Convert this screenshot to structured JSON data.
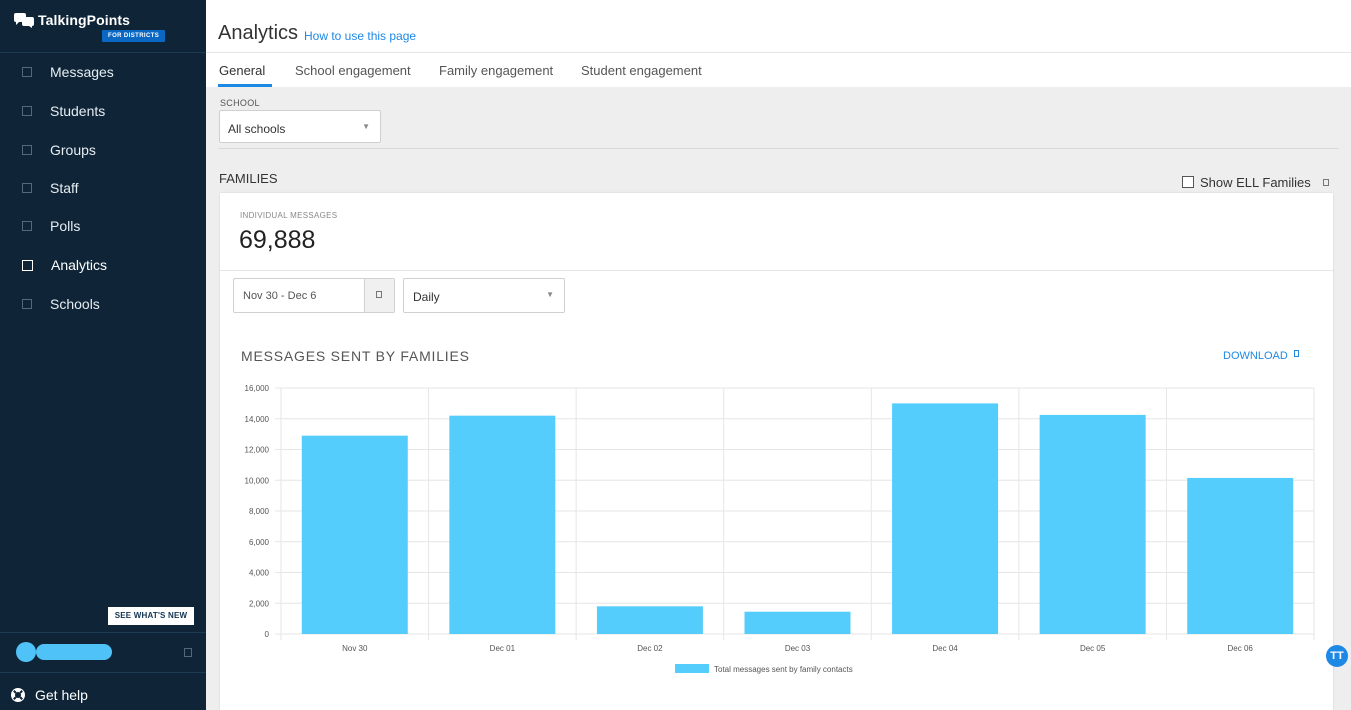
{
  "brand": {
    "name": "TalkingPoints",
    "badge": "FOR DISTRICTS"
  },
  "sidebar": {
    "items": [
      {
        "label": "Messages"
      },
      {
        "label": "Students"
      },
      {
        "label": "Groups"
      },
      {
        "label": "Staff"
      },
      {
        "label": "Polls"
      },
      {
        "label": "Analytics",
        "active": true
      },
      {
        "label": "Schools"
      }
    ],
    "whats_new": "SEE WHAT'S NEW",
    "get_help": "Get help"
  },
  "header": {
    "title": "Analytics",
    "help_link": "How to use this page"
  },
  "tabs": [
    {
      "label": "General",
      "active": true
    },
    {
      "label": "School engagement"
    },
    {
      "label": "Family engagement"
    },
    {
      "label": "Student engagement"
    }
  ],
  "filters": {
    "school_label": "SCHOOL",
    "school_value": "All schools"
  },
  "families": {
    "title": "FAMILIES",
    "ell_toggle_label": "Show ELL Families",
    "ell_checked": false,
    "individual_messages_label": "INDIVIDUAL MESSAGES",
    "individual_messages_value": "69,888",
    "date_range": "Nov 30 - Dec 6",
    "period": "Daily",
    "download_label": "DOWNLOAD"
  },
  "fab_label": "TT",
  "colors": {
    "sidebar_bg": "#0f2537",
    "accent": "#1e88e5",
    "bar": "#55cdfc"
  },
  "chart_data": {
    "type": "bar",
    "title": "MESSAGES SENT BY FAMILIES",
    "categories": [
      "Nov 30",
      "Dec 01",
      "Dec 02",
      "Dec 03",
      "Dec 04",
      "Dec 05",
      "Dec 06"
    ],
    "series": [
      {
        "name": "Total messages sent by family contacts",
        "values": [
          12900,
          14200,
          1800,
          1450,
          15000,
          14250,
          10150
        ]
      }
    ],
    "ylim": [
      0,
      16000
    ],
    "yticks": [
      0,
      2000,
      4000,
      6000,
      8000,
      10000,
      12000,
      14000,
      16000
    ],
    "ytick_labels": [
      "0",
      "2,000",
      "4,000",
      "6,000",
      "8,000",
      "10,000",
      "12,000",
      "14,000",
      "16,000"
    ],
    "grid": true,
    "legend_position": "bottom"
  }
}
